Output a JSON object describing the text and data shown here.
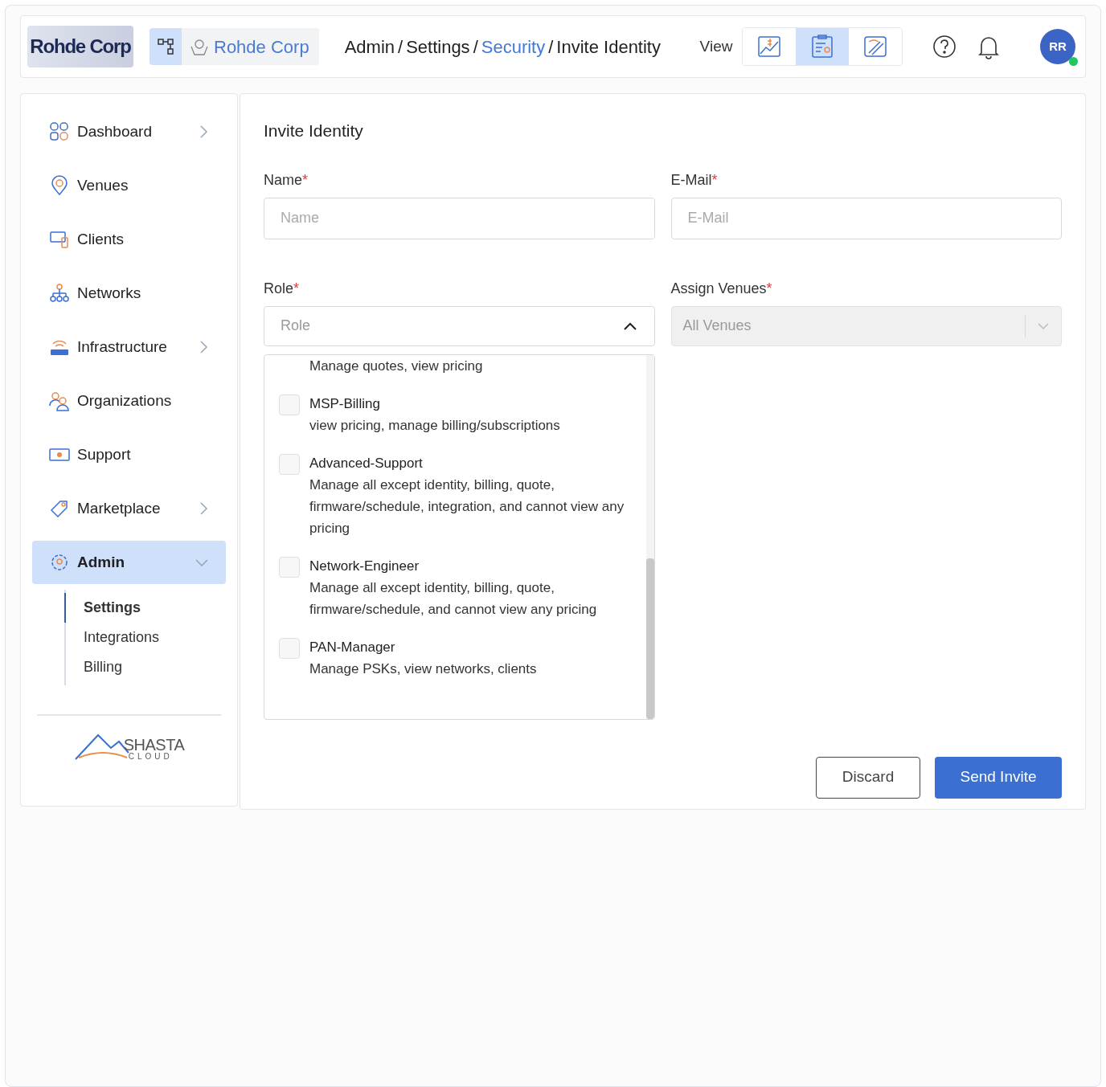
{
  "header": {
    "logo": "Rohde Corp",
    "org_name": "Rohde Corp",
    "breadcrumb_separator": "/",
    "breadcrumb": [
      {
        "label": "Admin",
        "link": false
      },
      {
        "label": "Settings",
        "link": false
      },
      {
        "label": "Security",
        "link": true
      },
      {
        "label": "Invite Identity",
        "link": false
      }
    ],
    "view_label": "View",
    "views": [
      {
        "kind": "billing",
        "selected": false
      },
      {
        "kind": "tasks",
        "selected": true
      },
      {
        "kind": "tools",
        "selected": false
      }
    ],
    "avatar": "RR",
    "online": true
  },
  "sidebar": {
    "items": [
      {
        "label": "Dashboard",
        "kind": "grid",
        "expanded": false,
        "selected": false
      },
      {
        "label": "Venues",
        "kind": "pin",
        "selected": false
      },
      {
        "label": "Clients",
        "kind": "devices",
        "selected": false
      },
      {
        "label": "Networks",
        "kind": "network",
        "selected": false
      },
      {
        "label": "Infrastructure",
        "kind": "router",
        "expanded": false,
        "selected": false
      },
      {
        "label": "Organizations",
        "kind": "people",
        "selected": false
      },
      {
        "label": "Support",
        "kind": "ticket",
        "selected": false
      },
      {
        "label": "Marketplace",
        "kind": "tag",
        "expanded": false,
        "selected": false
      },
      {
        "label": "Admin",
        "kind": "gear",
        "expanded": true,
        "selected": true,
        "children": [
          {
            "label": "Settings",
            "selected": true
          },
          {
            "label": "Integrations",
            "selected": false
          },
          {
            "label": "Billing",
            "selected": false
          }
        ]
      }
    ],
    "footer_logo": {
      "title": "SHASTA",
      "subtitle": "CLOUD"
    }
  },
  "form": {
    "title": "Invite Identity",
    "required_mark": "*",
    "name": {
      "label": "Name",
      "required": true,
      "placeholder": "Name"
    },
    "email": {
      "label": "E-Mail",
      "required": true,
      "placeholder": "E-Mail"
    },
    "role": {
      "label": "Role",
      "required": true,
      "placeholder": "Role",
      "expanded": true,
      "options": [
        {
          "description": "Manage quotes, view pricing"
        },
        {
          "name": "MSP-Billing",
          "description": "view pricing, manage billing/subscriptions",
          "checked": false
        },
        {
          "name": "Advanced-Support",
          "description": "Manage all except identity, billing, quote, firmware/schedule, integration, and cannot view any pricing",
          "checked": false
        },
        {
          "name": "Network-Engineer",
          "description": "Manage all except identity, billing, quote, firmware/schedule, and cannot view any pricing",
          "checked": false
        },
        {
          "name": "PAN-Manager",
          "description": "Manage PSKs, view networks, clients",
          "checked": false
        }
      ]
    },
    "venues": {
      "label": "Assign Venues",
      "required": true,
      "value": "All Venues",
      "disabled": true
    },
    "buttons": [
      {
        "label": "Discard",
        "kind": "secondary"
      },
      {
        "label": "Send Invite",
        "kind": "primary"
      }
    ]
  }
}
